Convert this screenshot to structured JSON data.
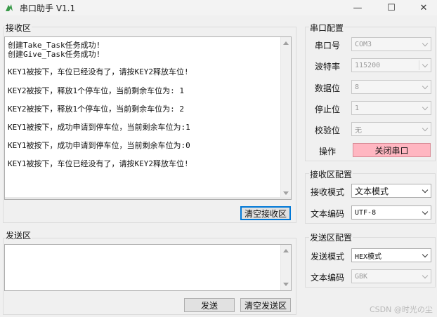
{
  "window": {
    "title": "串口助手 V1.1",
    "minimize": "—",
    "maximize": "☐",
    "close": "✕"
  },
  "receive": {
    "title": "接收区",
    "lines": [
      "创建Take_Task任务成功!",
      "创建Give_Task任务成功!",
      "KEY1被按下，车位已经没有了，请按KEY2释放车位!",
      "KEY2被按下，释放1个停车位，当前剩余车位为: 1",
      "KEY2被按下，释放1个停车位，当前剩余车位为: 2",
      "KEY1被按下，成功申请到停车位，当前剩余车位为:1",
      "KEY1被按下，成功申请到停车位，当前剩余车位为:0",
      "KEY1被按下，车位已经没有了，请按KEY2释放车位!"
    ],
    "clear_button": "清空接收区"
  },
  "send": {
    "title": "发送区",
    "text": "",
    "send_button": "发送",
    "clear_button": "清空发送区"
  },
  "serial_config": {
    "title": "串口配置",
    "port_label": "串口号",
    "port_value": "COM3",
    "baud_label": "波特率",
    "baud_value": "115200",
    "data_label": "数据位",
    "data_value": "8",
    "stop_label": "停止位",
    "stop_value": "1",
    "parity_label": "校验位",
    "parity_value": "无",
    "op_label": "操作",
    "close_port_button": "关闭串口",
    "close_port_color": "#ffb6c1"
  },
  "receive_config": {
    "title": "接收区配置",
    "mode_label": "接收模式",
    "mode_value": "文本模式",
    "encoding_label": "文本编码",
    "encoding_value": "UTF-8"
  },
  "send_config": {
    "title": "发送区配置",
    "mode_label": "发送模式",
    "mode_value": "HEX模式",
    "encoding_label": "文本编码",
    "encoding_value": "GBK"
  },
  "watermark": "CSDN @时光の尘"
}
